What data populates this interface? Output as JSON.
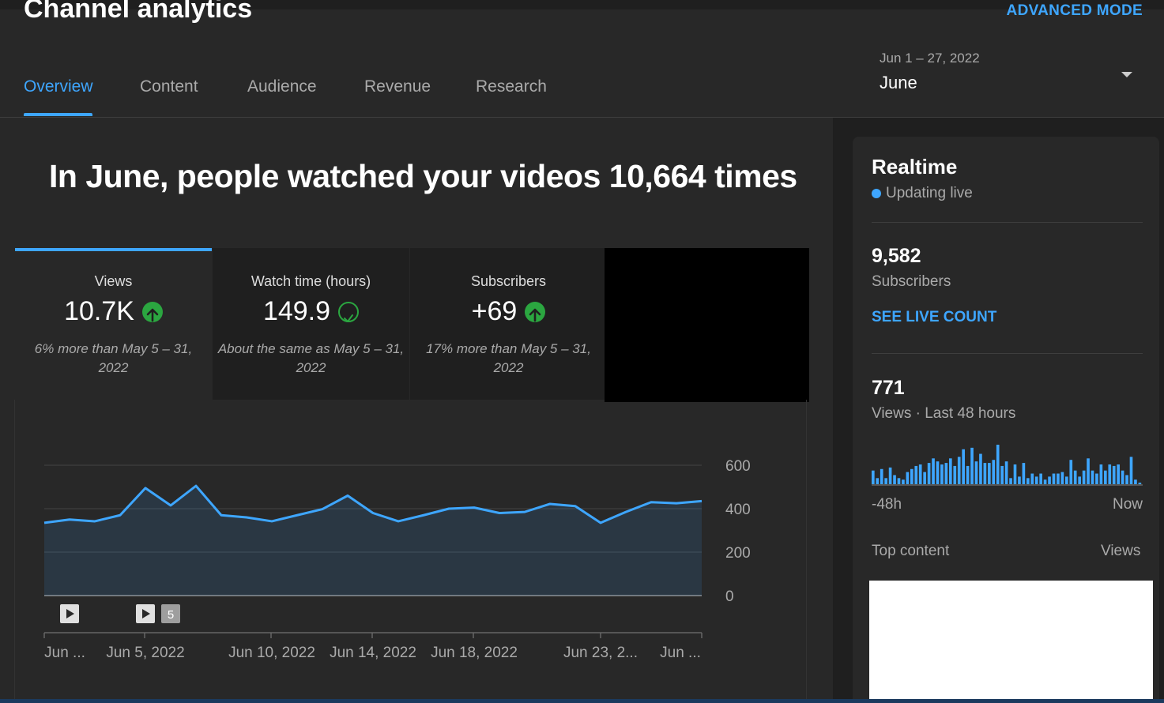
{
  "header": {
    "title": "Channel analytics",
    "advanced_mode": "ADVANCED MODE",
    "date_range": "Jun 1 – 27, 2022",
    "date_label": "June"
  },
  "tabs": [
    {
      "label": "Overview",
      "active": true
    },
    {
      "label": "Content"
    },
    {
      "label": "Audience"
    },
    {
      "label": "Revenue"
    },
    {
      "label": "Research"
    }
  ],
  "main": {
    "headline": "In June, people watched your videos 10,664 times",
    "cards": [
      {
        "label": "Views",
        "value": "10.7K",
        "indicator": "arrow-up-icon",
        "comparison": "6% more than May 5 – 31, 2022"
      },
      {
        "label": "Watch time (hours)",
        "value": "149.9",
        "indicator": "check-icon",
        "comparison": "About the same as May 5 – 31, 2022"
      },
      {
        "label": "Subscribers",
        "value": "+69",
        "indicator": "arrow-up-icon",
        "comparison": "17% more than May 5 – 31, 2022"
      }
    ],
    "video_marker_badge": "5"
  },
  "chart_data": {
    "type": "area",
    "title": "",
    "xlabel": "",
    "ylabel": "",
    "ylim": [
      0,
      600
    ],
    "yticks": [
      "600",
      "400",
      "200",
      "0"
    ],
    "grid": true,
    "legend": "none",
    "x_tick_labels": [
      "Jun ...",
      "Jun 5, 2022",
      "Jun 10, 2022",
      "Jun 14, 2022",
      "Jun 18, 2022",
      "Jun 23, 2...",
      "Jun ..."
    ],
    "x": [
      "Jun 1",
      "Jun 2",
      "Jun 3",
      "Jun 4",
      "Jun 5",
      "Jun 6",
      "Jun 7",
      "Jun 8",
      "Jun 9",
      "Jun 10",
      "Jun 11",
      "Jun 12",
      "Jun 13",
      "Jun 14",
      "Jun 15",
      "Jun 16",
      "Jun 17",
      "Jun 18",
      "Jun 19",
      "Jun 20",
      "Jun 21",
      "Jun 22",
      "Jun 23",
      "Jun 24",
      "Jun 25",
      "Jun 26",
      "Jun 27"
    ],
    "series": [
      {
        "values": [
          335,
          350,
          342,
          370,
          495,
          415,
          505,
          370,
          360,
          342,
          370,
          398,
          460,
          380,
          342,
          370,
          400,
          405,
          380,
          385,
          422,
          412,
          335,
          385,
          430,
          425,
          435
        ]
      }
    ],
    "color": "#3ea6ff"
  },
  "realtime": {
    "title": "Realtime",
    "status": "Updating live",
    "subscribers_value": "9,582",
    "subscribers_label": "Subscribers",
    "see_live_count": "SEE LIVE COUNT",
    "views_value": "771",
    "views_label": "Views · Last 48 hours",
    "axis_start": "-48h",
    "axis_end": "Now",
    "top_content_label": "Top content",
    "top_content_views": "Views",
    "bars": [
      9,
      4,
      10,
      4,
      11,
      6,
      4,
      3,
      8,
      10,
      12,
      13,
      8,
      14,
      17,
      15,
      13,
      14,
      17,
      12,
      18,
      23,
      12,
      24,
      15,
      20,
      14,
      14,
      16,
      26,
      12,
      15,
      4,
      13,
      5,
      14,
      4,
      7,
      5,
      7,
      3,
      5,
      7,
      7,
      8,
      5,
      16,
      9,
      5,
      9,
      17,
      9,
      7,
      13,
      9,
      13,
      12,
      13,
      9,
      6,
      18,
      3,
      1
    ],
    "bar_color": "#3ea6ff"
  }
}
